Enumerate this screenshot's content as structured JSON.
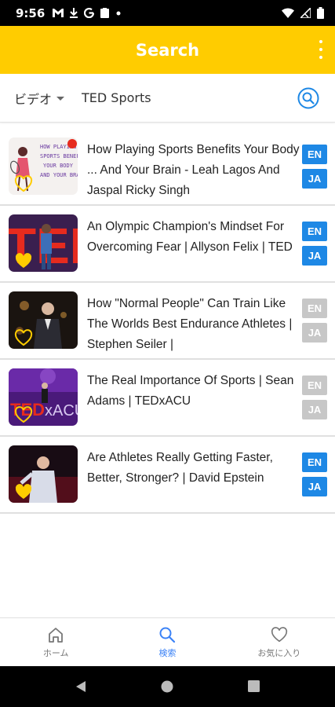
{
  "status_bar": {
    "time": "9:56",
    "icons": [
      "gmail-icon",
      "download-icon",
      "g-icon",
      "clipboard-icon",
      "dot-icon"
    ],
    "right_icons": [
      "wifi-icon",
      "signal-icon",
      "battery-icon"
    ]
  },
  "header": {
    "title": "Search",
    "accent": "#ffcc00"
  },
  "search": {
    "category": "ビデオ",
    "query": "TED Sports"
  },
  "videos": [
    {
      "title": "How Playing Sports Benefits Your Body ... And Your Brain - Leah Lagos And Jaspal Ricky Singh",
      "en": "EN",
      "ja": "JA",
      "en_active": true,
      "ja_active": true,
      "favorite": false
    },
    {
      "title": "An Olympic Champion's Mindset For Overcoming Fear | Allyson Felix | TED",
      "en": "EN",
      "ja": "JA",
      "en_active": true,
      "ja_active": true,
      "favorite": true
    },
    {
      "title": "How \"Normal People\" Can Train Like The Worlds Best Endurance Athletes | Stephen Seiler |",
      "en": "EN",
      "ja": "JA",
      "en_active": false,
      "ja_active": false,
      "favorite": false
    },
    {
      "title": "The Real Importance Of Sports | Sean Adams | TEDxACU",
      "en": "EN",
      "ja": "JA",
      "en_active": false,
      "ja_active": false,
      "favorite": false
    },
    {
      "title": "Are Athletes Really Getting Faster, Better, Stronger? | David Epstein",
      "en": "EN",
      "ja": "JA",
      "en_active": true,
      "ja_active": true,
      "favorite": true
    }
  ],
  "bottom_nav": {
    "home": "ホーム",
    "search": "検索",
    "favorites": "お気に入り"
  },
  "colors": {
    "active_blue": "#1e88e5",
    "inactive_gray": "#c7c7c7",
    "heart_yellow": "#ffcc00"
  }
}
